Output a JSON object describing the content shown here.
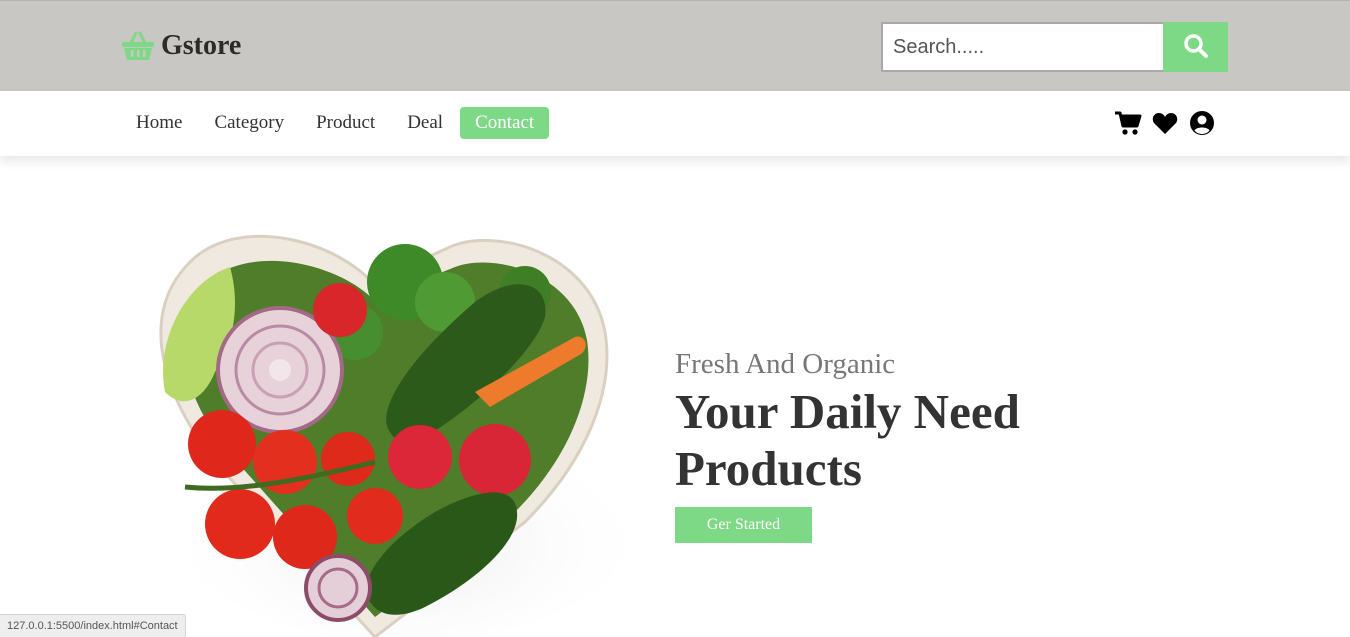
{
  "header": {
    "brand": "Gstore",
    "search_placeholder": "Search.....",
    "search_value": "",
    "colors": {
      "accent": "#7ed987",
      "topbar": "#c8c7c3"
    }
  },
  "nav": {
    "links": [
      {
        "label": "Home",
        "active": false
      },
      {
        "label": "Category",
        "active": false
      },
      {
        "label": "Product",
        "active": false
      },
      {
        "label": "Deal",
        "active": false
      },
      {
        "label": "Contact",
        "active": true
      }
    ],
    "icons": [
      "cart-icon",
      "heart-icon",
      "user-circle-icon"
    ]
  },
  "hero": {
    "subtitle": "Fresh And Organic",
    "title": "Your Daily Need Products",
    "button_label": "Ger Started",
    "image": "heart-shaped-bowl-of-vegetables"
  },
  "status": {
    "url": "127.0.0.1:5500/index.html#Contact"
  }
}
